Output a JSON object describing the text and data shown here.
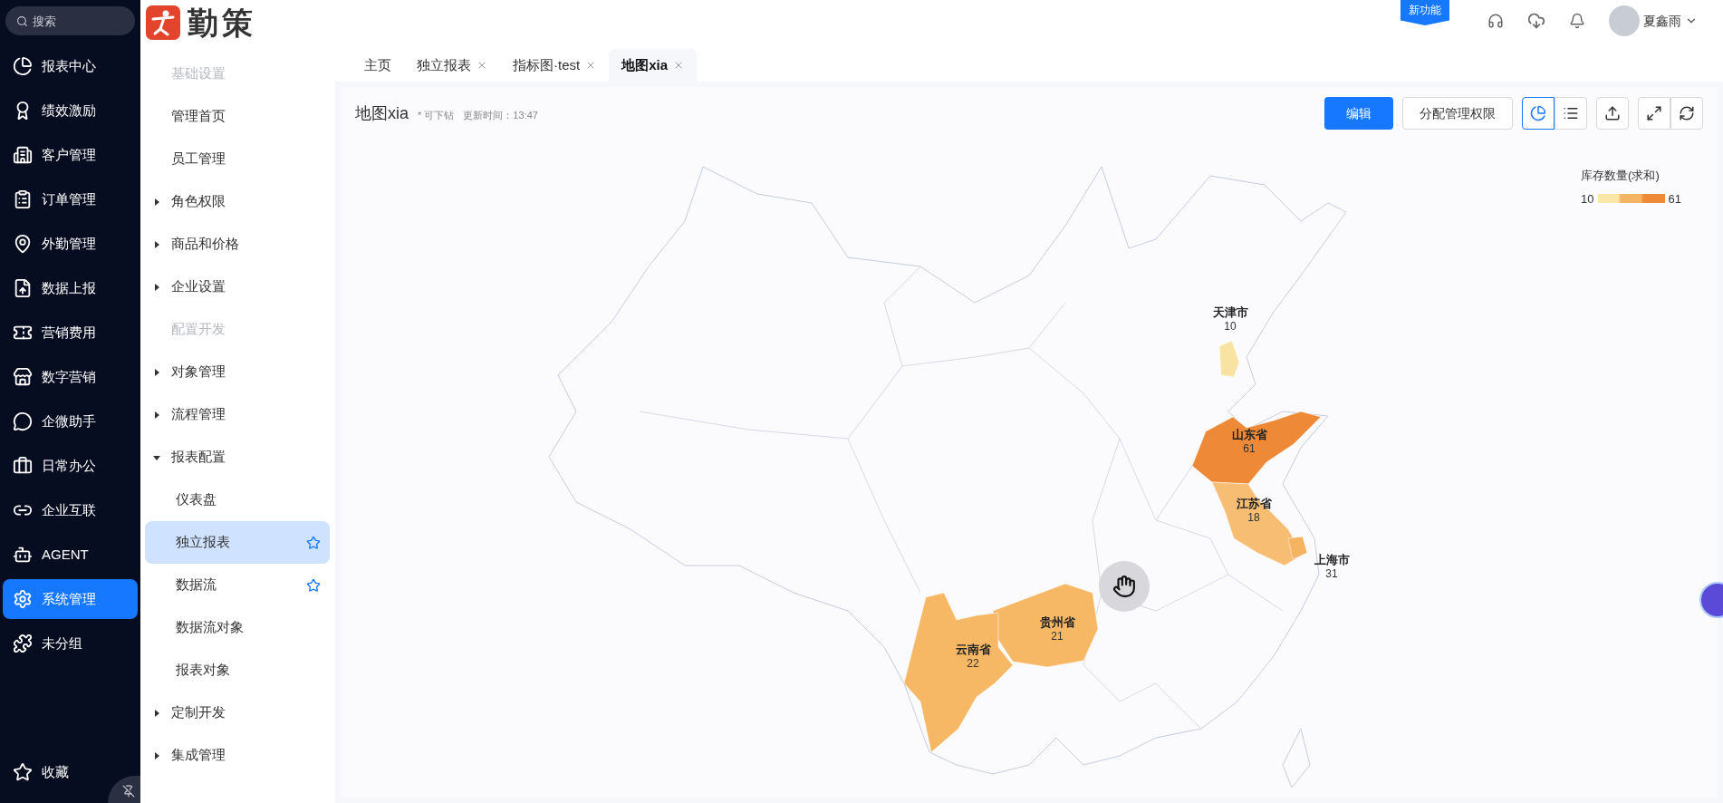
{
  "search": {
    "placeholder": "搜索"
  },
  "nav": [
    {
      "label": "报表中心",
      "selected": false
    },
    {
      "label": "绩效激励",
      "selected": false
    },
    {
      "label": "客户管理",
      "selected": false
    },
    {
      "label": "订单管理",
      "selected": false
    },
    {
      "label": "外勤管理",
      "selected": false
    },
    {
      "label": "数据上报",
      "selected": false
    },
    {
      "label": "营销费用",
      "selected": false
    },
    {
      "label": "数字营销",
      "selected": false
    },
    {
      "label": "企微助手",
      "selected": false
    },
    {
      "label": "日常办公",
      "selected": false
    },
    {
      "label": "企业互联",
      "selected": false
    },
    {
      "label": "AGENT",
      "selected": false
    },
    {
      "label": "系统管理",
      "selected": true
    },
    {
      "label": "未分组",
      "selected": false
    }
  ],
  "nav_bottom": {
    "label": "收藏"
  },
  "logo": {
    "text": "勤策"
  },
  "header": {
    "badge": "新功能",
    "user": "夏鑫雨"
  },
  "tabs": [
    {
      "label": "主页",
      "selected": false,
      "closable": false
    },
    {
      "label": "独立报表",
      "selected": false,
      "closable": true
    },
    {
      "label": "指标图·test",
      "selected": false,
      "closable": true
    },
    {
      "label": "地图xia",
      "selected": true,
      "closable": true
    }
  ],
  "menu": [
    {
      "kind": "section",
      "label": "基础设置"
    },
    {
      "kind": "item",
      "label": "管理首页"
    },
    {
      "kind": "item",
      "label": "员工管理"
    },
    {
      "kind": "group",
      "label": "角色权限",
      "expanded": false
    },
    {
      "kind": "group",
      "label": "商品和价格",
      "expanded": false
    },
    {
      "kind": "group",
      "label": "企业设置",
      "expanded": false
    },
    {
      "kind": "section",
      "label": "配置开发"
    },
    {
      "kind": "group",
      "label": "对象管理",
      "expanded": false
    },
    {
      "kind": "group",
      "label": "流程管理",
      "expanded": false
    },
    {
      "kind": "group",
      "label": "报表配置",
      "expanded": true,
      "children": [
        {
          "label": "仪表盘",
          "selected": false,
          "starred": false
        },
        {
          "label": "独立报表",
          "selected": true,
          "starred": true
        },
        {
          "label": "数据流",
          "selected": false,
          "starred": true
        },
        {
          "label": "数据流对象",
          "selected": false,
          "starred": false
        },
        {
          "label": "报表对象",
          "selected": false,
          "starred": false
        }
      ]
    },
    {
      "kind": "group",
      "label": "定制开发",
      "expanded": false
    },
    {
      "kind": "group",
      "label": "集成管理",
      "expanded": false
    }
  ],
  "report": {
    "title": "地图xia",
    "tag": "* 可下钻",
    "updated": "更新时间：13:47"
  },
  "toolbar": {
    "edit": "编辑",
    "permissions": "分配管理权限",
    "views": [
      {
        "selected": true
      },
      {
        "selected": false
      }
    ]
  },
  "legend": {
    "title": "库存数量(求和)",
    "min": "10",
    "max": "61"
  },
  "regions": [
    {
      "name": "天津市",
      "value": "10",
      "color": "#f9e3a3"
    },
    {
      "name": "山东省",
      "value": "61",
      "color": "#ee8a37"
    },
    {
      "name": "江苏省",
      "value": "18",
      "color": "#f7bd72"
    },
    {
      "name": "上海市",
      "value": "31",
      "color": "#f5b462"
    },
    {
      "name": "贵州省",
      "value": "21",
      "color": "#f7b866"
    },
    {
      "name": "云南省",
      "value": "22",
      "color": "#f7b866"
    }
  ]
}
